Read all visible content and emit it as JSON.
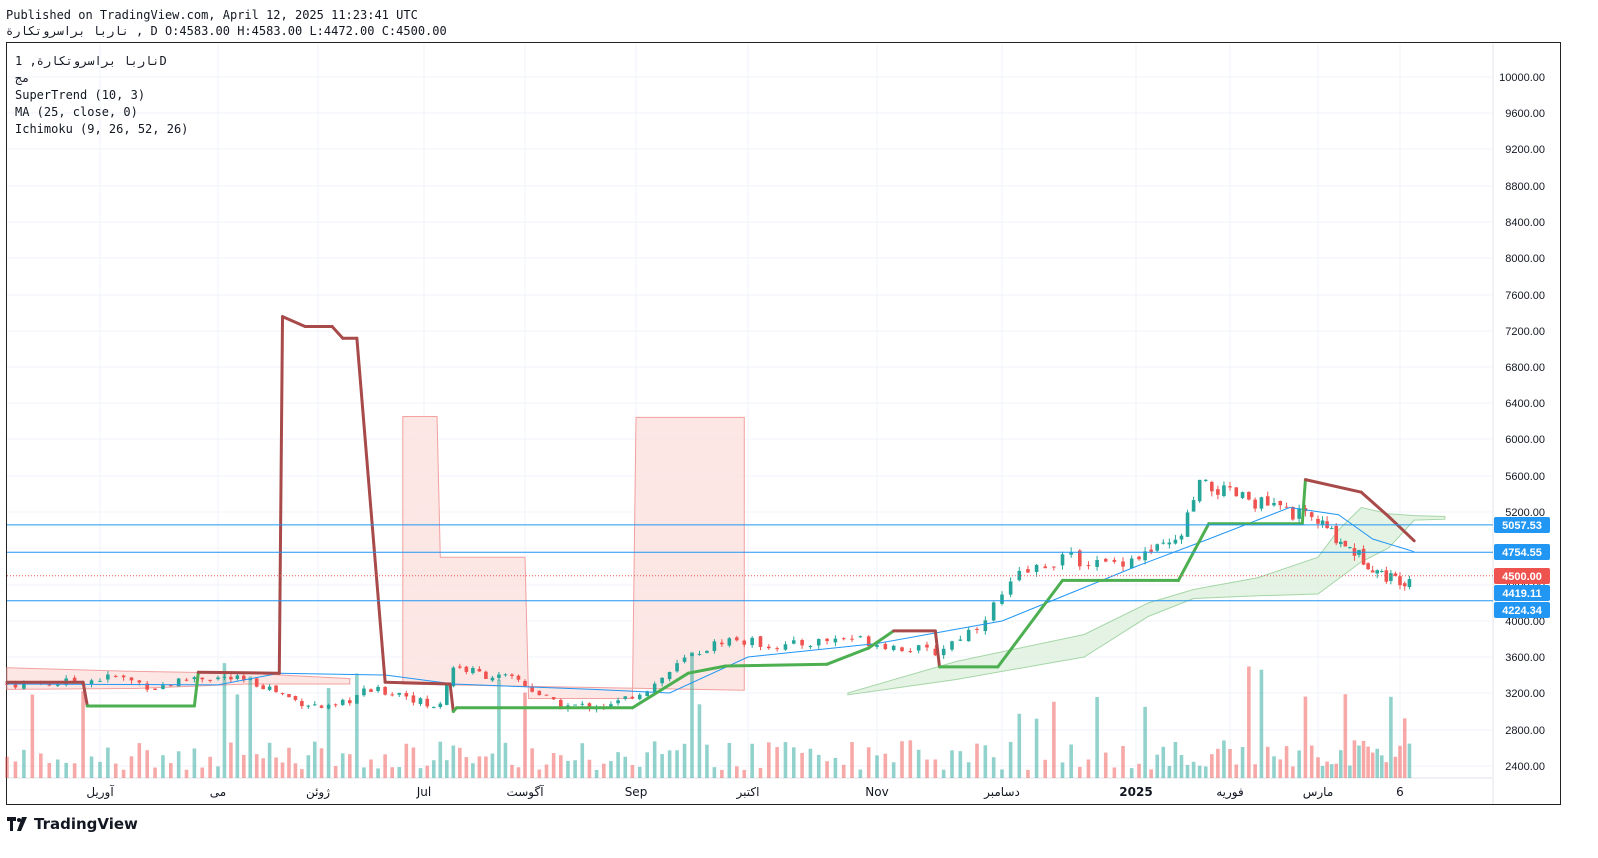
{
  "header": {
    "published": "Published on TradingView.com, April 12, 2025 11:23:41 UTC",
    "ohlc": "ناربا براسروتكارة , D O:4583.00 H:4583.00 L:4472.00 C:4500.00"
  },
  "legend": {
    "symbol": "ناربا براسروتكارة, 1D",
    "line2": "مج",
    "supertrend": "SuperTrend (10, 3)",
    "ma": "MA (25, close, 0)",
    "ichimoku": "Ichimoku (9, 26, 52, 26)"
  },
  "branding": {
    "name": "TradingView",
    "icon": "tradingview-logo-icon"
  },
  "colors": {
    "up": "#26a69a",
    "down": "#ef5350",
    "supertrend_up": "#4caf50",
    "supertrend_down": "#a84a4a",
    "ma": "#2196f3",
    "cloud_bull": "#d8eed9",
    "cloud_bear": "#fbe1df",
    "hline": "#2196f3"
  },
  "chart_data": {
    "type": "candlestick",
    "y_axis": {
      "ticks": [
        "10000.00",
        "9600.00",
        "9200.00",
        "8800.00",
        "8400.00",
        "8000.00",
        "7600.00",
        "7200.00",
        "6800.00",
        "6400.00",
        "6000.00",
        "5600.00",
        "5200.00",
        "4800.00",
        "4400.00",
        "4000.00",
        "3600.00",
        "3200.00",
        "2800.00",
        "2400.00"
      ],
      "ylim": [
        2250,
        10250
      ]
    },
    "x_axis": {
      "labels": [
        {
          "text": "آوریل",
          "date": "2024-04-01"
        },
        {
          "text": "می",
          "date": "2024-05-01"
        },
        {
          "text": "ژوئن",
          "date": "2024-06-01"
        },
        {
          "text": "Jul",
          "date": "2024-07-01"
        },
        {
          "text": "آگوست",
          "date": "2024-08-01"
        },
        {
          "text": "Sep",
          "date": "2024-09-01"
        },
        {
          "text": "اکتبر",
          "date": "2024-10-01"
        },
        {
          "text": "Nov",
          "date": "2024-11-01"
        },
        {
          "text": "دسامبر",
          "date": "2024-12-01"
        },
        {
          "text": "2025",
          "date": "2025-01-01"
        },
        {
          "text": "فوریه",
          "date": "2025-02-01"
        },
        {
          "text": "مارس",
          "date": "2025-03-01"
        },
        {
          "text": "6",
          "date": "2025-04-06"
        }
      ],
      "start": "2024-03-10",
      "end": "2025-05-15"
    },
    "price_labels": [
      {
        "value": "5057.53",
        "color": "#2196f3"
      },
      {
        "value": "4754.55",
        "color": "#2196f3"
      },
      {
        "value": "4500.00",
        "color": "#ef5350"
      },
      {
        "value": "4419.11",
        "color": "#2196f3"
      },
      {
        "value": "4224.34",
        "color": "#2196f3"
      }
    ],
    "hlines": [
      5057.53,
      4754.55,
      4224.34
    ],
    "last_price": 4500.0,
    "price_path": [
      [
        "2024-03-10",
        3300
      ],
      [
        "2024-03-25",
        3320
      ],
      [
        "2024-04-05",
        3380
      ],
      [
        "2024-04-15",
        3260
      ],
      [
        "2024-04-25",
        3380
      ],
      [
        "2024-05-05",
        3360
      ],
      [
        "2024-05-15",
        3290
      ],
      [
        "2024-05-25",
        3120
      ],
      [
        "2024-06-05",
        3020
      ],
      [
        "2024-06-15",
        3230
      ],
      [
        "2024-06-25",
        3200
      ],
      [
        "2024-07-05",
        3010
      ],
      [
        "2024-07-10",
        3500
      ],
      [
        "2024-07-20",
        3400
      ],
      [
        "2024-07-30",
        3340
      ],
      [
        "2024-08-10",
        3060
      ],
      [
        "2024-08-25",
        3060
      ],
      [
        "2024-09-05",
        3270
      ],
      [
        "2024-09-15",
        3600
      ],
      [
        "2024-09-25",
        3800
      ],
      [
        "2024-10-10",
        3720
      ],
      [
        "2024-10-25",
        3820
      ],
      [
        "2024-11-05",
        3720
      ],
      [
        "2024-11-15",
        3650
      ],
      [
        "2024-11-25",
        3950
      ],
      [
        "2024-12-05",
        4500
      ],
      [
        "2024-12-15",
        4700
      ],
      [
        "2024-12-25",
        4620
      ],
      [
        "2025-01-05",
        4750
      ],
      [
        "2025-01-15",
        4860
      ],
      [
        "2025-01-22",
        5500
      ],
      [
        "2025-02-05",
        5360
      ],
      [
        "2025-02-20",
        5200
      ],
      [
        "2025-03-01",
        5100
      ],
      [
        "2025-03-10",
        4900
      ],
      [
        "2025-03-20",
        4700
      ],
      [
        "2025-03-30",
        4500
      ],
      [
        "2025-04-08",
        4450
      ],
      [
        "2025-04-12",
        4500
      ]
    ],
    "supertrend": [
      [
        "2024-03-10",
        3320,
        "down"
      ],
      [
        "2024-03-28",
        3320,
        "down"
      ],
      [
        "2024-03-29",
        3060,
        "up"
      ],
      [
        "2024-04-25",
        3060,
        "up"
      ],
      [
        "2024-04-26",
        3430,
        "down"
      ],
      [
        "2024-05-20",
        3420,
        "down"
      ],
      [
        "2024-05-21",
        7360,
        "down"
      ],
      [
        "2024-05-28",
        7250,
        "down"
      ],
      [
        "2024-06-05",
        7250,
        "down"
      ],
      [
        "2024-06-08",
        7120,
        "down"
      ],
      [
        "2024-06-12",
        7120,
        "down"
      ],
      [
        "2024-06-20",
        3320,
        "down"
      ],
      [
        "2024-07-09",
        3300,
        "down"
      ],
      [
        "2024-07-10",
        3000,
        "up"
      ],
      [
        "2024-07-11",
        3040,
        "up"
      ],
      [
        "2024-08-31",
        3040,
        "up"
      ],
      [
        "2024-09-15",
        3420,
        "up"
      ],
      [
        "2024-09-25",
        3500,
        "up"
      ],
      [
        "2024-10-20",
        3520,
        "up"
      ],
      [
        "2024-10-30",
        3700,
        "up"
      ],
      [
        "2024-11-05",
        3890,
        "down"
      ],
      [
        "2024-11-15",
        3890,
        "down"
      ],
      [
        "2024-11-16",
        3490,
        "up"
      ],
      [
        "2024-11-30",
        3490,
        "up"
      ],
      [
        "2024-12-15",
        4450,
        "up"
      ],
      [
        "2025-01-15",
        4450,
        "up"
      ],
      [
        "2025-01-25",
        5070,
        "up"
      ],
      [
        "2025-02-24",
        5070,
        "up"
      ],
      [
        "2025-02-25",
        5560,
        "down"
      ],
      [
        "2025-03-20",
        5420,
        "down"
      ],
      [
        "2025-04-01",
        5150,
        "down"
      ],
      [
        "2025-04-12",
        4880,
        "down"
      ]
    ],
    "ma": [
      [
        "2024-03-10",
        3300
      ],
      [
        "2024-05-01",
        3290
      ],
      [
        "2024-05-20",
        3420
      ],
      [
        "2024-06-20",
        3400
      ],
      [
        "2024-07-10",
        3300
      ],
      [
        "2024-08-20",
        3240
      ],
      [
        "2024-09-10",
        3200
      ],
      [
        "2024-10-01",
        3600
      ],
      [
        "2024-11-01",
        3750
      ],
      [
        "2024-12-01",
        4000
      ],
      [
        "2025-01-01",
        4600
      ],
      [
        "2025-01-25",
        4900
      ],
      [
        "2025-02-20",
        5250
      ],
      [
        "2025-03-10",
        5170
      ],
      [
        "2025-03-25",
        4900
      ],
      [
        "2025-04-12",
        4760
      ]
    ],
    "cloud_bear": [
      [
        [
          "2024-06-25",
          6250
        ],
        [
          "2024-07-05",
          6250
        ],
        [
          "2024-07-06",
          4700
        ],
        [
          "2024-08-01",
          4700
        ],
        [
          "2024-08-02",
          3140
        ],
        [
          "2024-08-31",
          3140
        ],
        [
          "2024-09-01",
          6240
        ],
        [
          "2024-09-30",
          6240
        ]
      ],
      [
        [
          "2024-06-25",
          3300
        ],
        [
          "2024-09-30",
          3230
        ]
      ]
    ],
    "volume": {
      "ylim": [
        0,
        16000
      ],
      "note": "volume bars at bottom"
    }
  }
}
